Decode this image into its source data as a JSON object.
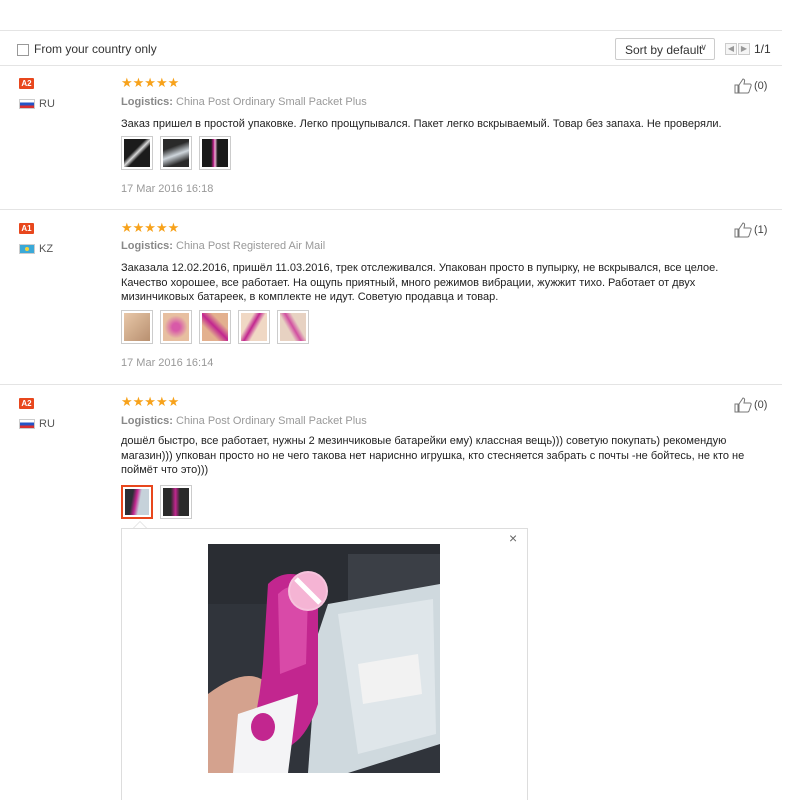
{
  "filter": {
    "label": "From your country only",
    "checked": false
  },
  "sort": {
    "label": "Sort by default"
  },
  "pagination": {
    "text": "1/1"
  },
  "reviews": [
    {
      "badge": "A2",
      "country": "RU",
      "stars": "★★★★★",
      "logistics_label": "Logistics:",
      "logistics": "China Post Ordinary Small Packet Plus",
      "text": "Заказ пришел в простой упаковке. Легко прощупывался. Пакет легко вскрываемый. Товар без запаха. Не проверяли.",
      "date": "17 Mar 2016 16:18",
      "likes": "(0)"
    },
    {
      "badge": "A1",
      "country": "KZ",
      "stars": "★★★★★",
      "logistics_label": "Logistics:",
      "logistics": "China Post Registered Air Mail",
      "text": "Заказала 12.02.2016, пришёл 11.03.2016, трек отслеживался. Упакован просто в пупырку, не вскрывался, все целое. Качество хорошее, все работает. На ощупь приятный, много режимов вибрации, жужжит тихо. Работает от двух мизинчиковых батареек, в комплекте не идут. Советую продавца и товар.",
      "date": "17 Mar 2016 16:14",
      "likes": "(1)"
    },
    {
      "badge": "A2",
      "country": "RU",
      "stars": "★★★★★",
      "logistics_label": "Logistics:",
      "logistics": "China Post Ordinary Small Packet Plus",
      "text": "дошёл быстро, все работает, нужны 2 мезинчиковые батарейки ему) классная вещь))) советую покупать) рекомендую магазин))) упкован просто но не чего такова нет нарисннo игрушка, кто стесняется забрать с почты -не бойтесь, не кто не поймёт что это)))",
      "likes": "(0)"
    }
  ],
  "popup": {
    "close": "×"
  },
  "colors": {
    "badge": "#e8471d",
    "star": "#f7a21b",
    "product": "#c2268f"
  }
}
